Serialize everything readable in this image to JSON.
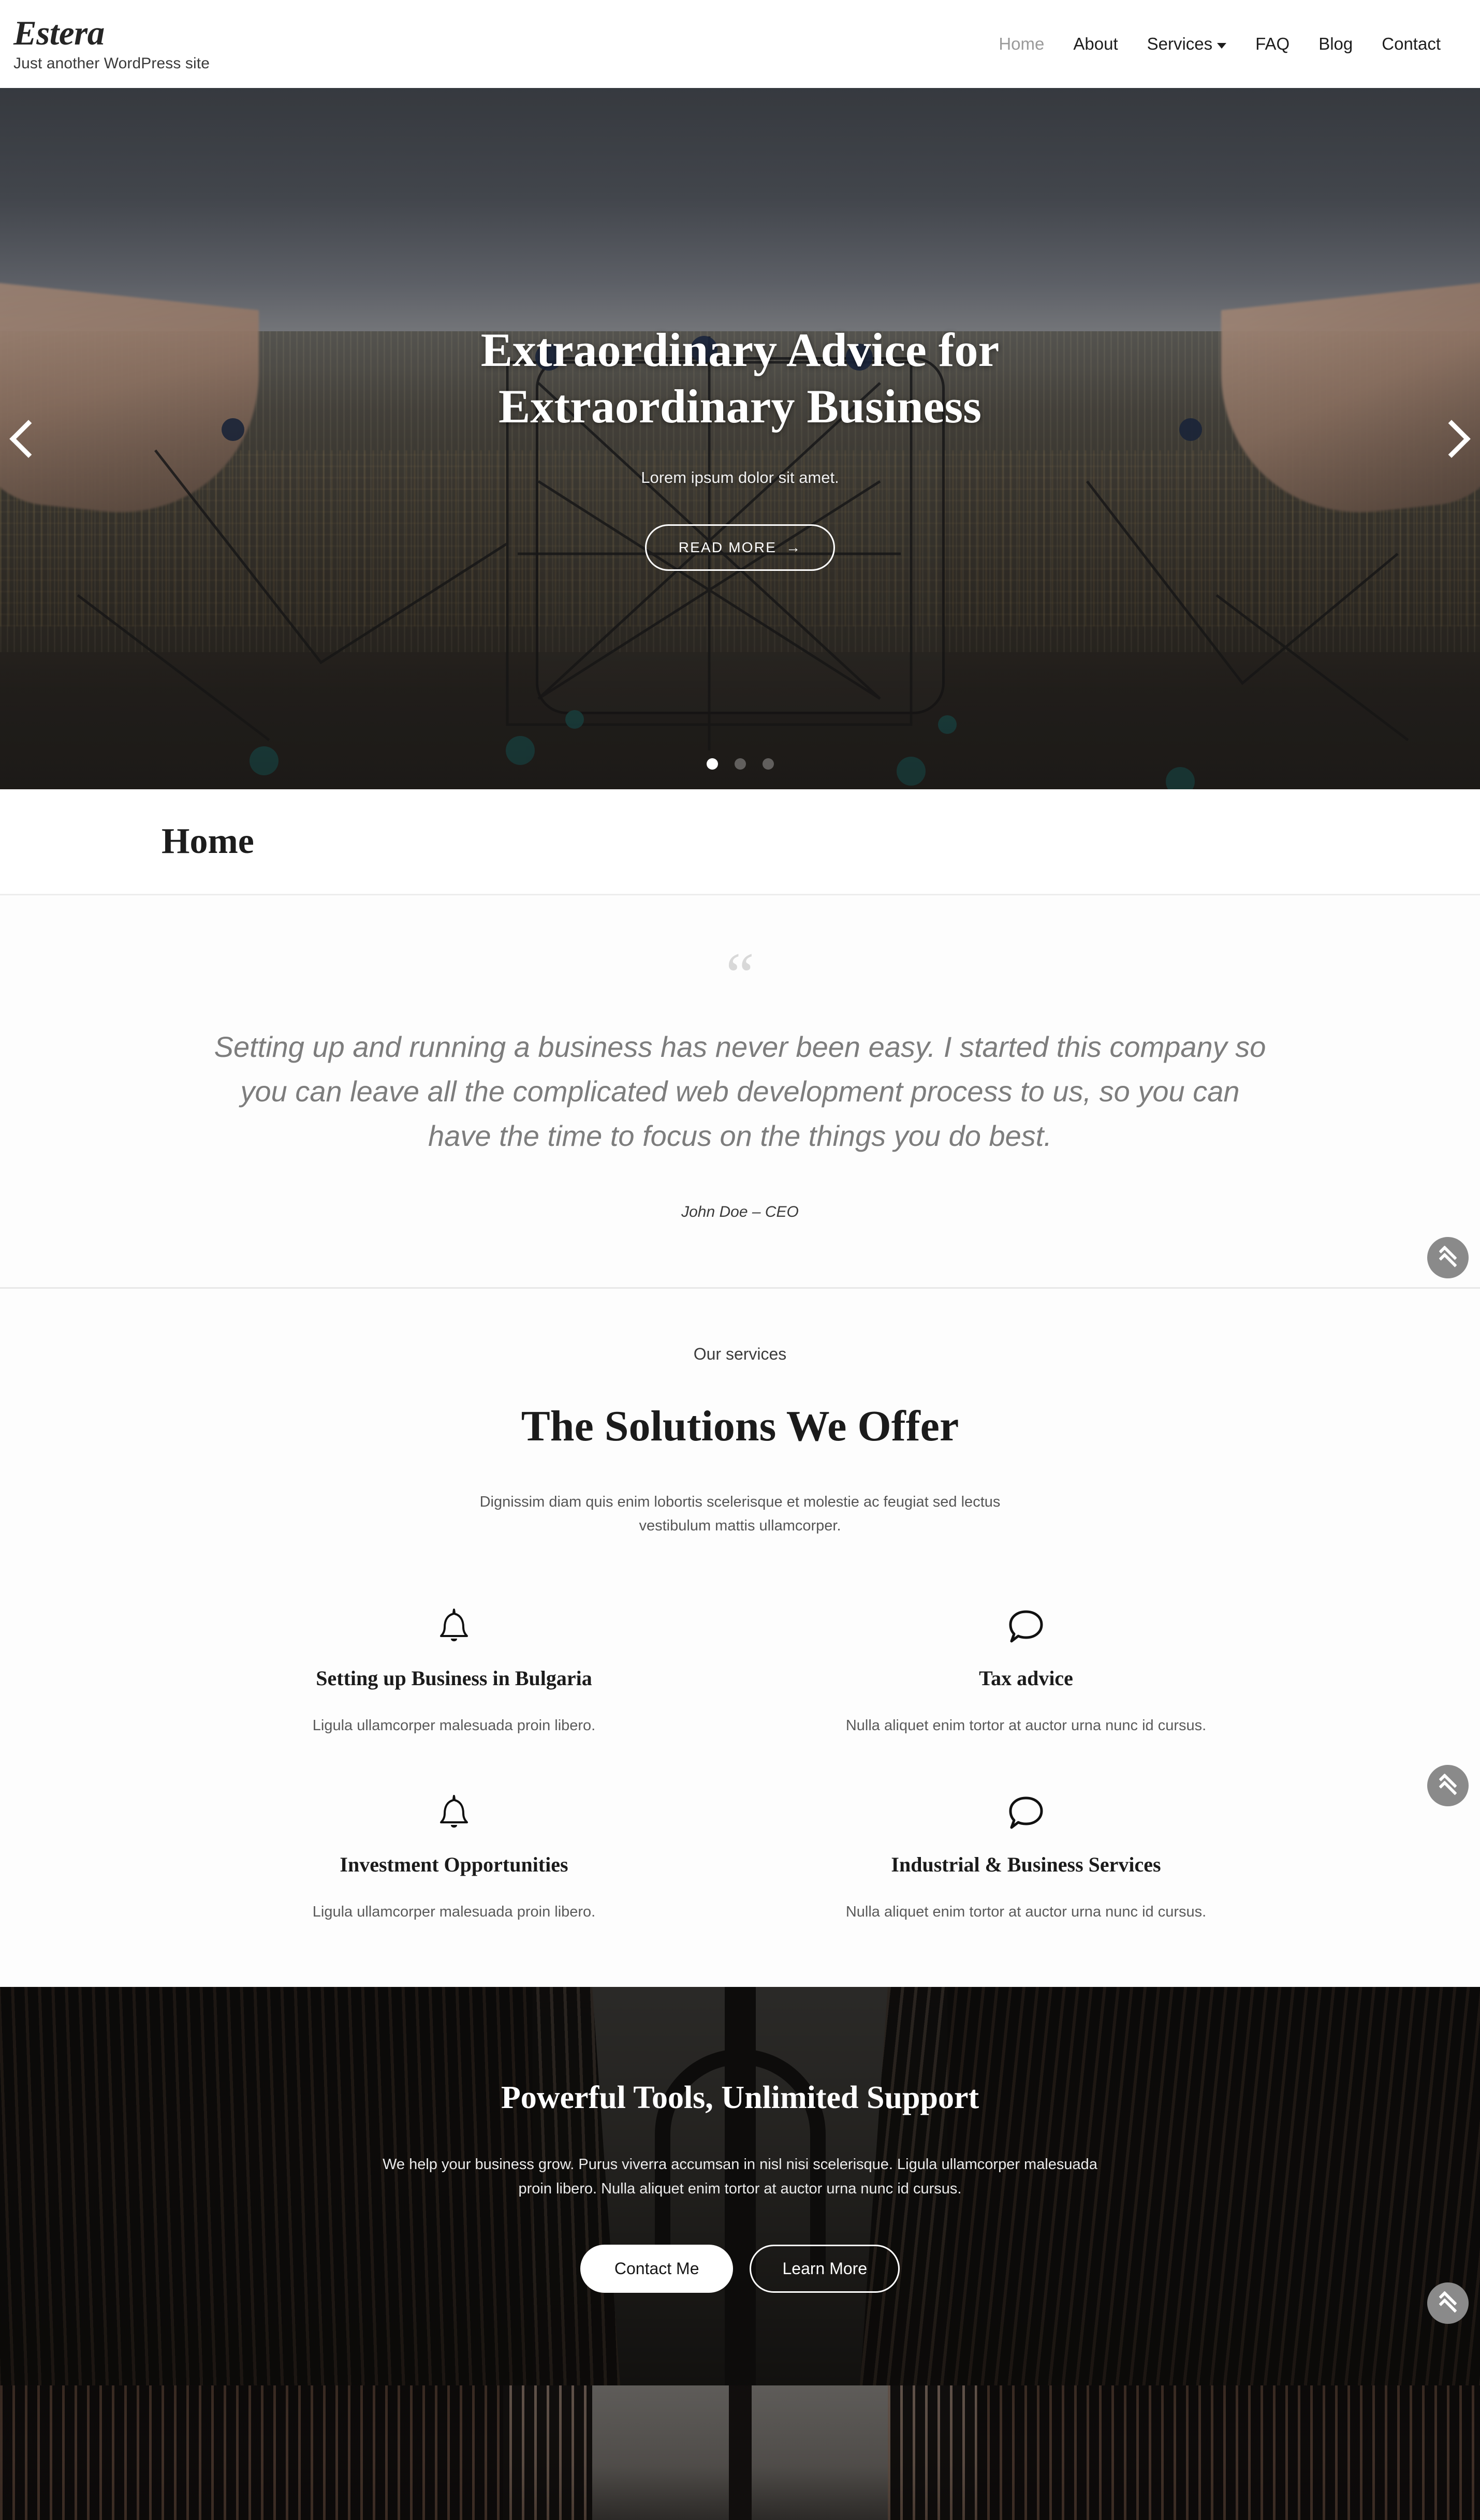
{
  "header": {
    "brand_title": "Estera",
    "brand_tagline": "Just another WordPress site",
    "nav": [
      {
        "label": "Home",
        "active": true,
        "has_dropdown": false
      },
      {
        "label": "About",
        "active": false,
        "has_dropdown": false
      },
      {
        "label": "Services",
        "active": false,
        "has_dropdown": true
      },
      {
        "label": "FAQ",
        "active": false,
        "has_dropdown": false
      },
      {
        "label": "Blog",
        "active": false,
        "has_dropdown": false
      },
      {
        "label": "Contact",
        "active": false,
        "has_dropdown": false
      }
    ]
  },
  "hero": {
    "title": "Extraordinary Advice for Extraordinary Business",
    "subtitle": "Lorem ipsum dolor sit amet.",
    "button_label": "READ MORE",
    "button_arrow": "→",
    "prev_icon": "chevron-left-icon",
    "next_icon": "chevron-right-icon",
    "slide_count": 3,
    "active_slide": 1
  },
  "page_title": "Home",
  "testimonial": {
    "quote_glyph": "“",
    "quote": "Setting up and running a business has never been easy. I started this company so you can leave all the complicated web development process to us, so you can have the time to focus on the things you do best.",
    "author": "John Doe – CEO"
  },
  "services": {
    "eyebrow": "Our services",
    "heading": "The Solutions We Offer",
    "intro": "Dignissim diam quis enim lobortis scelerisque et molestie ac feugiat sed lectus vestibulum mattis ullamcorper.",
    "items": [
      {
        "icon": "bell-icon",
        "title": "Setting up Business in Bulgaria",
        "desc": "Ligula ullamcorper malesuada proin libero."
      },
      {
        "icon": "speech-bubble-icon",
        "title": "Tax advice",
        "desc": "Nulla aliquet enim tortor at auctor urna nunc id cursus."
      },
      {
        "icon": "bell-icon",
        "title": "Investment Opportunities",
        "desc": "Ligula ullamcorper malesuada proin libero."
      },
      {
        "icon": "speech-bubble-icon",
        "title": "Industrial & Business Services",
        "desc": "Nulla aliquet enim tortor at auctor urna nunc id cursus."
      }
    ]
  },
  "cta": {
    "title": "Powerful Tools, Unlimited Support",
    "text": "We help your business grow. Purus viverra accumsan in nisl nisi scelerisque. Ligula ullamcorper malesuada proin libero. Nulla aliquet enim tortor at auctor urna nunc id cursus.",
    "primary_button": "Contact Me",
    "secondary_button": "Learn More"
  },
  "scroll_top": {
    "icon": "double-chevron-up-icon",
    "color": "#8a8a8a"
  },
  "colors": {
    "page_bg": "#ffffff",
    "text_dark": "#1b1b1b",
    "text_muted": "#7d7d7d",
    "nav_active": "#9a9a9a",
    "divider": "#e8e8e8",
    "cta_bg": "#161212"
  }
}
